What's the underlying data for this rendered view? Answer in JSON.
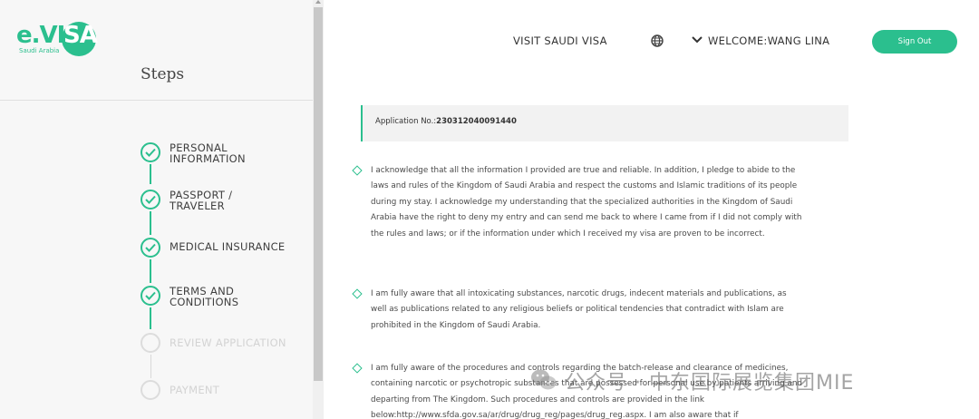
{
  "brand": {
    "logo_text": "e.VI",
    "logo_circle_text": "SA",
    "logo_sub": "Saudi Arabia",
    "accent_color": "#2bbf8e"
  },
  "sidebar": {
    "title": "Steps",
    "steps": [
      {
        "line1": "PERSONAL",
        "line2": "INFORMATION",
        "status": "done"
      },
      {
        "line1": "PASSPORT /",
        "line2": "TRAVELER",
        "status": "done"
      },
      {
        "line1": "MEDICAL INSURANCE",
        "line2": "",
        "status": "done"
      },
      {
        "line1": "TERMS AND",
        "line2": "CONDITIONS",
        "status": "done"
      },
      {
        "line1": "REVIEW APPLICATION",
        "line2": "",
        "status": "pending"
      },
      {
        "line1": "PAYMENT",
        "line2": "",
        "status": "pending"
      }
    ]
  },
  "header": {
    "visit_link": "VISIT SAUDI VISA",
    "language_icon": "globe-icon",
    "welcome": "WELCOME:WANG LINA",
    "signout_label": "Sign Out"
  },
  "application": {
    "label": "Application No.:",
    "number": "230312040091440"
  },
  "terms": [
    "I acknowledge that all the information I provided are true and reliable. In addition, I pledge to abide to the laws and rules of the Kingdom of Saudi Arabia and respect the customs and Islamic traditions of its people during my stay. I acknowledge my understanding that the specialized authorities in the Kingdom of Saudi Arabia have the right to deny my entry and can send me back to where I came from if I did not comply with the rules and laws; or if the information under which I received my visa are proven to be incorrect.",
    "I am fully aware that all intoxicating substances, narcotic drugs, indecent materials and publications, as well as publications related to any religious beliefs or political tendencies that contradict with Islam are prohibited in the Kingdom of Saudi Arabia.",
    "I am fully aware of the procedures and controls regarding the batch-release and clearance of medicines, containing narcotic or psychotropic substances that are possessed for personal use by patients arriving and departing from The Kingdom. Such procedures and controls are provided in the link below:http://www.sfda.gov.sa/ar/drug/drug_reg/pages/drug_reg.aspx. I am also aware that if"
  ],
  "watermark": {
    "text": "公众号 · 中东国际展览集团MIE"
  }
}
